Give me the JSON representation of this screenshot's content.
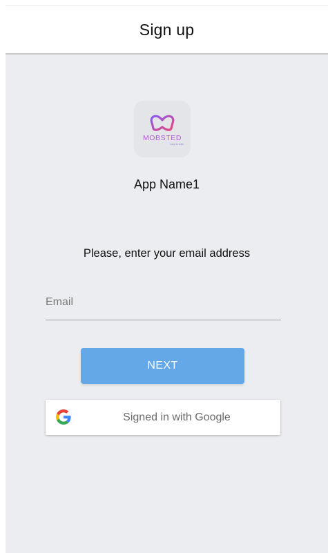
{
  "header": {
    "title": "Sign up"
  },
  "app": {
    "logo_text": "MOBSTED",
    "logo_tagline": "easy to build",
    "name": "App Name1"
  },
  "form": {
    "prompt": "Please, enter your email address",
    "email_placeholder": "Email",
    "email_value": "",
    "next_label": "NEXT"
  },
  "google": {
    "label": "Signed in with Google",
    "icon": "google-g-icon"
  },
  "colors": {
    "background": "#ebedf0",
    "next_button": "#65a8e8",
    "logo_gradient_start": "#8a5cf0",
    "logo_gradient_end": "#e8457c"
  }
}
